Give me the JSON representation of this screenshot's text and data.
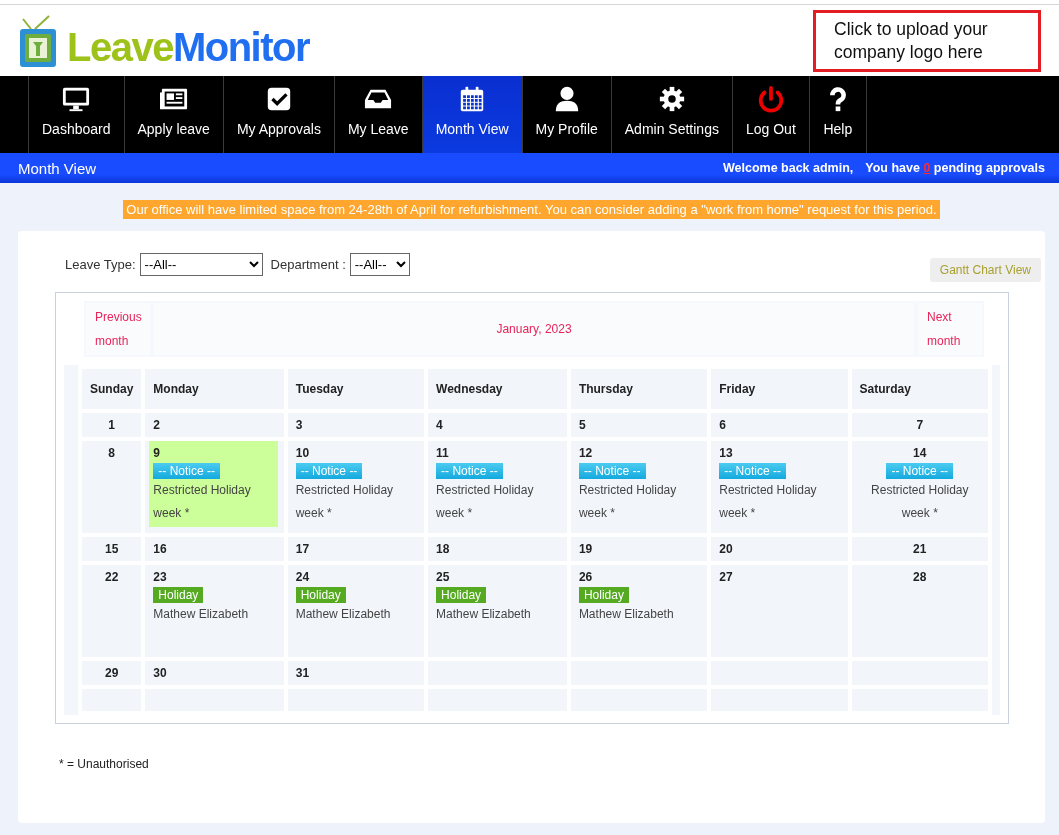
{
  "logo": {
    "part_1": "Leave",
    "part_2": "Monitor"
  },
  "upload_logo": "Click to upload your company logo here",
  "nav": [
    {
      "label": "Dashboard",
      "selected": false
    },
    {
      "label": "Apply leave",
      "selected": false
    },
    {
      "label": "My Approvals",
      "selected": false
    },
    {
      "label": "My Leave",
      "selected": false
    },
    {
      "label": "Month View",
      "selected": true
    },
    {
      "label": "My Profile",
      "selected": false
    },
    {
      "label": "Admin Settings",
      "selected": false
    },
    {
      "label": "Log Out",
      "selected": false
    },
    {
      "label": "Help",
      "selected": false
    }
  ],
  "page_bar": {
    "title": "Month View",
    "welcome": "Welcome back admin,",
    "pending_prefix": "You have",
    "pending_count": "0",
    "pending_suffix": "pending approvals"
  },
  "announcement": "Our office will have limited space from 24-28th of April for refurbishment. You can consider adding a \"work from home\" request for this period.",
  "filters": [
    {
      "label": "Leave Type:",
      "value": "--All--",
      "kind": "wide"
    },
    {
      "label": "Department :",
      "value": "--All--",
      "kind": "narrow"
    }
  ],
  "gantt_button": "Gantt Chart View",
  "calendar": {
    "previous": "Previous month",
    "month": "January, 2023",
    "next": "Next month",
    "weekdays": [
      "Sunday",
      "Monday",
      "Tuesday",
      "Wednesday",
      "Thursday",
      "Friday",
      "Saturday"
    ],
    "weeks": [
      [
        {
          "day": "1"
        },
        {
          "day": "2"
        },
        {
          "day": "3"
        },
        {
          "day": "4"
        },
        {
          "day": "5"
        },
        {
          "day": "6"
        },
        {
          "day": "7"
        }
      ],
      [
        {
          "day": "8"
        },
        {
          "day": "9",
          "highlighted": true,
          "events": [
            {
              "kind": "notice",
              "badge": "-- Notice --",
              "text": "Restricted Holiday week *"
            }
          ]
        },
        {
          "day": "10",
          "highlighted": false,
          "events": [
            {
              "kind": "notice",
              "badge": "-- Notice --",
              "text": "Restricted Holiday week *"
            }
          ]
        },
        {
          "day": "11",
          "highlighted": false,
          "events": [
            {
              "kind": "notice",
              "badge": "-- Notice --",
              "text": "Restricted Holiday week *"
            }
          ]
        },
        {
          "day": "12",
          "highlighted": false,
          "events": [
            {
              "kind": "notice",
              "badge": "-- Notice --",
              "text": "Restricted Holiday week *"
            }
          ]
        },
        {
          "day": "13",
          "highlighted": false,
          "events": [
            {
              "kind": "notice",
              "badge": "-- Notice --",
              "text": "Restricted Holiday week *"
            }
          ]
        },
        {
          "day": "14",
          "highlighted": false,
          "events": [
            {
              "kind": "notice",
              "badge": "-- Notice --",
              "text": "Restricted Holiday week *"
            }
          ]
        }
      ],
      [
        {
          "day": "15"
        },
        {
          "day": "16"
        },
        {
          "day": "17"
        },
        {
          "day": "18"
        },
        {
          "day": "19"
        },
        {
          "day": "20"
        },
        {
          "day": "21"
        }
      ],
      [
        {
          "day": "22"
        },
        {
          "day": "23",
          "events": [
            {
              "kind": "holiday",
              "badge": "Holiday",
              "text": "Mathew Elizabeth"
            }
          ]
        },
        {
          "day": "24",
          "events": [
            {
              "kind": "holiday",
              "badge": "Holiday",
              "text": "Mathew Elizabeth"
            }
          ]
        },
        {
          "day": "25",
          "events": [
            {
              "kind": "holiday",
              "badge": "Holiday",
              "text": "Mathew Elizabeth"
            }
          ]
        },
        {
          "day": "26",
          "events": [
            {
              "kind": "holiday",
              "badge": "Holiday",
              "text": "Mathew Elizabeth"
            }
          ]
        },
        {
          "day": "27"
        },
        {
          "day": "28"
        }
      ],
      [
        {
          "day": "29"
        },
        {
          "day": "30"
        },
        {
          "day": "31"
        }
      ]
    ]
  },
  "legend": "* = Unauthorised"
}
